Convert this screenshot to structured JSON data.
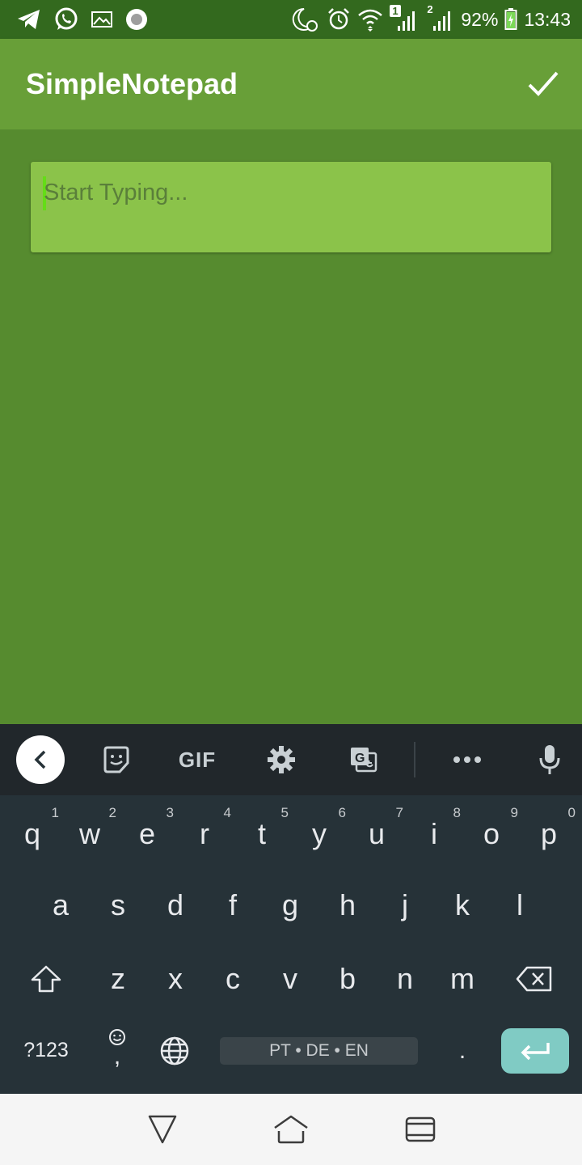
{
  "status_bar": {
    "battery": "92%",
    "time": "13:43",
    "sim1_badge": "1",
    "sim2_badge": "2",
    "left_icons": [
      "telegram-icon",
      "whatsapp-icon",
      "gallery-icon",
      "record-icon"
    ],
    "right_icons": [
      "night-mode-icon",
      "alarm-icon",
      "wifi-icon",
      "signal-icon",
      "battery-icon"
    ]
  },
  "app_bar": {
    "title": "SimpleNotepad",
    "confirm_icon": "checkmark-icon"
  },
  "editor": {
    "placeholder": "Start Typing..."
  },
  "keyboard_toolbar": {
    "gif_label": "GIF",
    "icons": [
      "back-chevron-icon",
      "sticker-icon",
      "settings-gear-icon",
      "translate-icon",
      "more-dots-icon",
      "microphone-icon"
    ]
  },
  "keyboard": {
    "row1": [
      {
        "key": "q",
        "hint": "1"
      },
      {
        "key": "w",
        "hint": "2"
      },
      {
        "key": "e",
        "hint": "3"
      },
      {
        "key": "r",
        "hint": "4"
      },
      {
        "key": "t",
        "hint": "5"
      },
      {
        "key": "y",
        "hint": "6"
      },
      {
        "key": "u",
        "hint": "7"
      },
      {
        "key": "i",
        "hint": "8"
      },
      {
        "key": "o",
        "hint": "9"
      },
      {
        "key": "p",
        "hint": "0"
      }
    ],
    "row2": [
      "a",
      "s",
      "d",
      "f",
      "g",
      "h",
      "j",
      "k",
      "l"
    ],
    "row3": [
      "z",
      "x",
      "c",
      "v",
      "b",
      "n",
      "m"
    ],
    "symbols_label": "?123",
    "comma_label": ",",
    "space_label": "PT • DE • EN",
    "period_label": ".",
    "accent_color": "#80cbc4"
  },
  "colors": {
    "status_bar": "#33691e",
    "app_bar": "#689f38",
    "content_bg": "#568b2f",
    "editor_bg": "#8bc34a",
    "keyboard_bg": "#263238"
  },
  "nav_bar": {
    "icons": [
      "back-triangle-icon",
      "home-icon",
      "recents-icon"
    ]
  }
}
